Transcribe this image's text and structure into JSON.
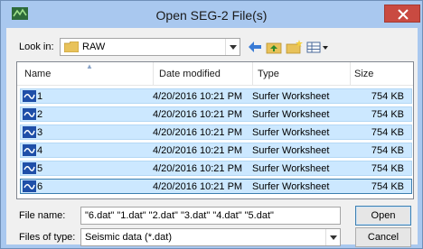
{
  "window": {
    "title": "Open SEG-2 File(s)"
  },
  "toolbar": {
    "lookin_label": "Look in:",
    "lookin_value": "RAW"
  },
  "columns": {
    "name": "Name",
    "date": "Date modified",
    "type": "Type",
    "size": "Size"
  },
  "files": [
    {
      "name": "1",
      "date": "4/20/2016 10:21 PM",
      "type": "Surfer Worksheet",
      "size": "754 KB"
    },
    {
      "name": "2",
      "date": "4/20/2016 10:21 PM",
      "type": "Surfer Worksheet",
      "size": "754 KB"
    },
    {
      "name": "3",
      "date": "4/20/2016 10:21 PM",
      "type": "Surfer Worksheet",
      "size": "754 KB"
    },
    {
      "name": "4",
      "date": "4/20/2016 10:21 PM",
      "type": "Surfer Worksheet",
      "size": "754 KB"
    },
    {
      "name": "5",
      "date": "4/20/2016 10:21 PM",
      "type": "Surfer Worksheet",
      "size": "754 KB"
    },
    {
      "name": "6",
      "date": "4/20/2016 10:21 PM",
      "type": "Surfer Worksheet",
      "size": "754 KB"
    }
  ],
  "filename": {
    "label": "File name:",
    "value": "\"6.dat\" \"1.dat\" \"2.dat\" \"3.dat\" \"4.dat\" \"5.dat\""
  },
  "filetype": {
    "label": "Files of type:",
    "value": "Seismic data (*.dat)"
  },
  "buttons": {
    "open": "Open",
    "cancel": "Cancel"
  },
  "colors": {
    "selection": "#cce8ff",
    "titlebar": "#a9c8ef",
    "close": "#c94a41"
  }
}
